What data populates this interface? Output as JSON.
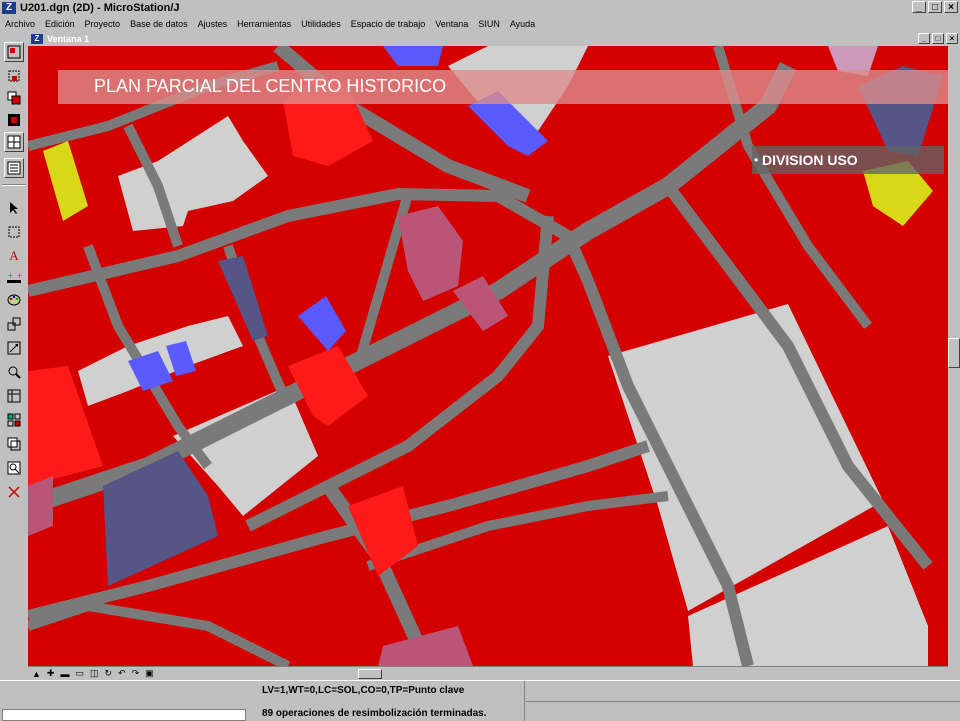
{
  "app": {
    "title": "U201.dgn (2D) - MicroStation/J",
    "icon": "microstation-logo-icon",
    "window_controls": [
      "_",
      "□",
      "×"
    ]
  },
  "menu": [
    "Archivo",
    "Edición",
    "Proyecto",
    "Base de datos",
    "Ajustes",
    "Herramientas",
    "Utilidades",
    "Espacio de trabajo",
    "Ventana",
    "SIUN",
    "Ayuda"
  ],
  "view": {
    "title": "Ventana 1",
    "window_controls": [
      "_",
      "□",
      "×"
    ]
  },
  "overlay": {
    "banner_title": "PLAN PARCIAL DEL CENTRO HISTORICO",
    "legend_bullet": "•",
    "legend_label": "DIVISION USO"
  },
  "map_colors": {
    "residential": "#d40000",
    "commercial": "#ff1a1a",
    "street": "#7a7a7a",
    "public": "#d0d0d0",
    "institutional_blue": "#5a5aff",
    "institutional_dark": "#555588",
    "mixed_pink": "#bb5577",
    "yellow": "#d8d818"
  },
  "status": {
    "line1": "LV=1,WT=0,LC=SOL,CO=0,TP=Punto clave",
    "line2": "89 operaciones de resimbolización terminadas."
  }
}
